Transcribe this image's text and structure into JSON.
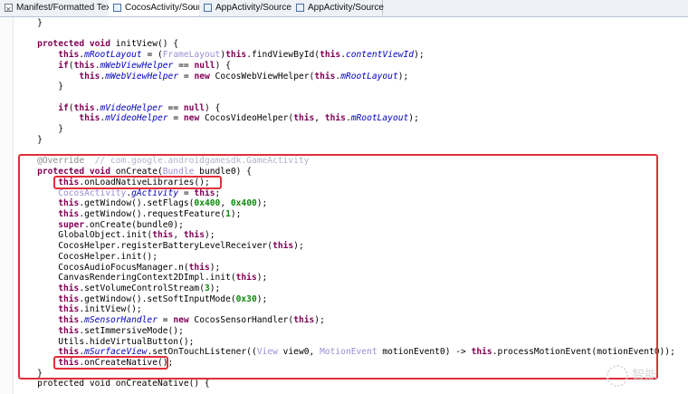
{
  "tabs": [
    {
      "label": "Manifest/Formatted Text",
      "icon": "xml-file-icon",
      "active": false,
      "closable": false
    },
    {
      "label": "CocosActivity/Source",
      "icon": "java-file-icon",
      "active": true,
      "closable": true
    },
    {
      "label": "AppActivity/Source",
      "icon": "java-file-icon",
      "active": false,
      "closable": false
    },
    {
      "label": "AppActivity/Source",
      "icon": "java-file-icon",
      "active": false,
      "closable": false
    }
  ],
  "close_glyph": "×",
  "code_lines": [
    {
      "indent": 4,
      "tokens": [
        [
          "p",
          "}"
        ]
      ]
    },
    {
      "indent": 0,
      "tokens": []
    },
    {
      "indent": 4,
      "tokens": [
        [
          "k",
          "protected"
        ],
        [
          "p",
          " "
        ],
        [
          "k",
          "void"
        ],
        [
          "p",
          " initView() {"
        ]
      ]
    },
    {
      "indent": 8,
      "tokens": [
        [
          "k",
          "this"
        ],
        [
          "p",
          "."
        ],
        [
          "f",
          "mRootLayout"
        ],
        [
          "p",
          " = ("
        ],
        [
          "t",
          "FrameLayout"
        ],
        [
          "p",
          ")"
        ],
        [
          "k",
          "this"
        ],
        [
          "p",
          ".findViewById("
        ],
        [
          "k",
          "this"
        ],
        [
          "p",
          "."
        ],
        [
          "f",
          "contentViewId"
        ],
        [
          "p",
          ");"
        ]
      ]
    },
    {
      "indent": 8,
      "tokens": [
        [
          "k",
          "if"
        ],
        [
          "p",
          "("
        ],
        [
          "k",
          "this"
        ],
        [
          "p",
          "."
        ],
        [
          "f",
          "mWebViewHelper"
        ],
        [
          "p",
          " == "
        ],
        [
          "k",
          "null"
        ],
        [
          "p",
          ") {"
        ]
      ]
    },
    {
      "indent": 12,
      "tokens": [
        [
          "k",
          "this"
        ],
        [
          "p",
          "."
        ],
        [
          "f",
          "mWebViewHelper"
        ],
        [
          "p",
          " = "
        ],
        [
          "k",
          "new"
        ],
        [
          "p",
          " CocosWebViewHelper("
        ],
        [
          "k",
          "this"
        ],
        [
          "p",
          "."
        ],
        [
          "f",
          "mRootLayout"
        ],
        [
          "p",
          ");"
        ]
      ]
    },
    {
      "indent": 8,
      "tokens": [
        [
          "p",
          "}"
        ]
      ]
    },
    {
      "indent": 0,
      "tokens": []
    },
    {
      "indent": 8,
      "tokens": [
        [
          "k",
          "if"
        ],
        [
          "p",
          "("
        ],
        [
          "k",
          "this"
        ],
        [
          "p",
          "."
        ],
        [
          "f",
          "mVideoHelper"
        ],
        [
          "p",
          " == "
        ],
        [
          "k",
          "null"
        ],
        [
          "p",
          ") {"
        ]
      ]
    },
    {
      "indent": 12,
      "tokens": [
        [
          "k",
          "this"
        ],
        [
          "p",
          "."
        ],
        [
          "f",
          "mVideoHelper"
        ],
        [
          "p",
          " = "
        ],
        [
          "k",
          "new"
        ],
        [
          "p",
          " CocosVideoHelper("
        ],
        [
          "k",
          "this"
        ],
        [
          "p",
          ", "
        ],
        [
          "k",
          "this"
        ],
        [
          "p",
          "."
        ],
        [
          "f",
          "mRootLayout"
        ],
        [
          "p",
          ");"
        ]
      ]
    },
    {
      "indent": 8,
      "tokens": [
        [
          "p",
          "}"
        ]
      ]
    },
    {
      "indent": 4,
      "tokens": [
        [
          "p",
          "}"
        ]
      ]
    },
    {
      "indent": 0,
      "tokens": []
    },
    {
      "indent": 4,
      "tokens": [
        [
          "a",
          "@Override"
        ],
        [
          "c",
          "  // com.google.androidgamesdk.GameActivity"
        ]
      ]
    },
    {
      "indent": 4,
      "tokens": [
        [
          "k",
          "protected"
        ],
        [
          "p",
          " "
        ],
        [
          "k",
          "void"
        ],
        [
          "p",
          " onCreate("
        ],
        [
          "t",
          "Bundle"
        ],
        [
          "p",
          " bundle0) {"
        ]
      ]
    },
    {
      "indent": 8,
      "tokens": [
        [
          "k",
          "this"
        ],
        [
          "p",
          ".onLoadNativeLibraries();"
        ]
      ]
    },
    {
      "indent": 8,
      "tokens": [
        [
          "t",
          "CocosActivity"
        ],
        [
          "p",
          "."
        ],
        [
          "f",
          "gActivity"
        ],
        [
          "p",
          " = "
        ],
        [
          "k",
          "this"
        ],
        [
          "p",
          ";"
        ]
      ]
    },
    {
      "indent": 8,
      "tokens": [
        [
          "k",
          "this"
        ],
        [
          "p",
          ".getWindow().setFlags("
        ],
        [
          "n",
          "0x400"
        ],
        [
          "p",
          ", "
        ],
        [
          "n",
          "0x400"
        ],
        [
          "p",
          ");"
        ]
      ]
    },
    {
      "indent": 8,
      "tokens": [
        [
          "k",
          "this"
        ],
        [
          "p",
          ".getWindow().requestFeature("
        ],
        [
          "n",
          "1"
        ],
        [
          "p",
          ");"
        ]
      ]
    },
    {
      "indent": 8,
      "tokens": [
        [
          "k",
          "super"
        ],
        [
          "p",
          ".onCreate(bundle0);"
        ]
      ]
    },
    {
      "indent": 8,
      "tokens": [
        [
          "p",
          "GlobalObject.init("
        ],
        [
          "k",
          "this"
        ],
        [
          "p",
          ", "
        ],
        [
          "k",
          "this"
        ],
        [
          "p",
          ");"
        ]
      ]
    },
    {
      "indent": 8,
      "tokens": [
        [
          "p",
          "CocosHelper.registerBatteryLevelReceiver("
        ],
        [
          "k",
          "this"
        ],
        [
          "p",
          ");"
        ]
      ]
    },
    {
      "indent": 8,
      "tokens": [
        [
          "p",
          "CocosHelper.init();"
        ]
      ]
    },
    {
      "indent": 8,
      "tokens": [
        [
          "p",
          "CocosAudioFocusManager.n("
        ],
        [
          "k",
          "this"
        ],
        [
          "p",
          ");"
        ]
      ]
    },
    {
      "indent": 8,
      "tokens": [
        [
          "p",
          "CanvasRenderingContext2DImpl.init("
        ],
        [
          "k",
          "this"
        ],
        [
          "p",
          ");"
        ]
      ]
    },
    {
      "indent": 8,
      "tokens": [
        [
          "k",
          "this"
        ],
        [
          "p",
          ".setVolumeControlStream("
        ],
        [
          "n",
          "3"
        ],
        [
          "p",
          ");"
        ]
      ]
    },
    {
      "indent": 8,
      "tokens": [
        [
          "k",
          "this"
        ],
        [
          "p",
          ".getWindow().setSoftInputMode("
        ],
        [
          "n",
          "0x30"
        ],
        [
          "p",
          ");"
        ]
      ]
    },
    {
      "indent": 8,
      "tokens": [
        [
          "k",
          "this"
        ],
        [
          "p",
          ".initView();"
        ]
      ]
    },
    {
      "indent": 8,
      "tokens": [
        [
          "k",
          "this"
        ],
        [
          "p",
          "."
        ],
        [
          "f",
          "mSensorHandler"
        ],
        [
          "p",
          " = "
        ],
        [
          "k",
          "new"
        ],
        [
          "p",
          " CocosSensorHandler("
        ],
        [
          "k",
          "this"
        ],
        [
          "p",
          ");"
        ]
      ]
    },
    {
      "indent": 8,
      "tokens": [
        [
          "k",
          "this"
        ],
        [
          "p",
          ".setImmersiveMode();"
        ]
      ]
    },
    {
      "indent": 8,
      "tokens": [
        [
          "p",
          "Utils.hideVirtualButton();"
        ]
      ]
    },
    {
      "indent": 8,
      "tokens": [
        [
          "k",
          "this"
        ],
        [
          "p",
          "."
        ],
        [
          "f",
          "mSurfaceView"
        ],
        [
          "p",
          ".setOnTouchListener(("
        ],
        [
          "t",
          "View"
        ],
        [
          "p",
          " view0, "
        ],
        [
          "t",
          "MotionEvent"
        ],
        [
          "p",
          " motionEvent0) -> "
        ],
        [
          "k",
          "this"
        ],
        [
          "p",
          ".processMotionEvent(motionEvent0));"
        ]
      ]
    },
    {
      "indent": 8,
      "tokens": [
        [
          "k",
          "this"
        ],
        [
          "p",
          ".onCreateNative();"
        ]
      ]
    },
    {
      "indent": 4,
      "tokens": [
        [
          "p",
          "}"
        ]
      ]
    },
    {
      "indent": 0,
      "tokens": [
        [
          "p",
          "    protected void onCreateNative() {"
        ]
      ]
    }
  ],
  "highlights": [
    {
      "name": "highlight-oncreate-method",
      "from_line": 13,
      "to_line": 33
    },
    {
      "name": "highlight-onloadnativelibraries",
      "from_line": 15,
      "to_line": 15
    },
    {
      "name": "highlight-oncreatenative",
      "from_line": 32,
      "to_line": 32
    }
  ],
  "colors": {
    "keyword": "#7f0055",
    "field": "#0000c0",
    "type": "#9b8fd4",
    "number": "#0a8a0a",
    "annotation": "#8a8a8a",
    "comment": "#b3b3c9",
    "highlight_border": "#e0303a"
  },
  "watermark": {
    "text": "智能",
    "icon": "watermark-icon"
  }
}
